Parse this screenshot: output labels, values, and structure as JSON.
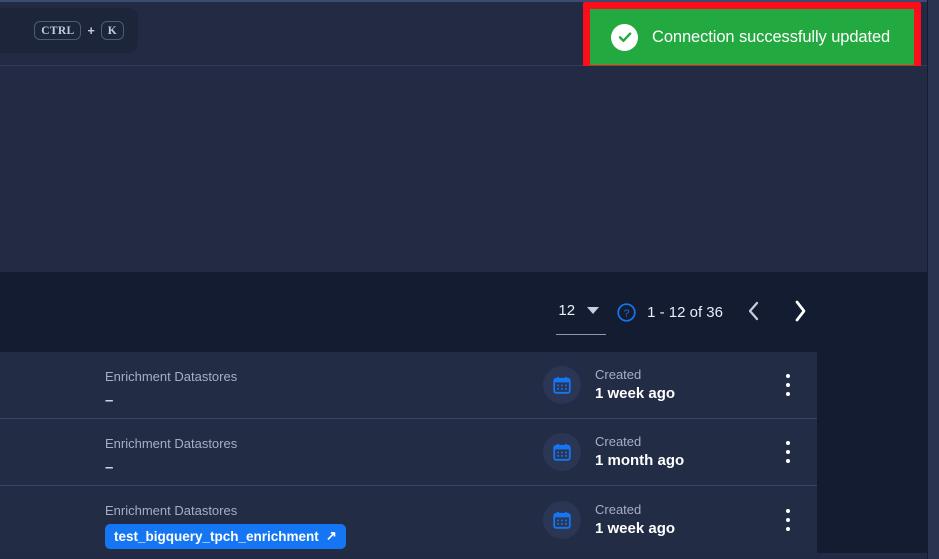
{
  "colors": {
    "app_background": "#1b2338",
    "header_band": "#222b43",
    "toolbar_background": "#141c32",
    "row_background": "#232c45",
    "toast_green": "#22a93f",
    "annotation_red": "#fc0d1b",
    "accent_blue": "#1476f2",
    "muted_text": "#a6aec4"
  },
  "header": {
    "search": {
      "shortcut_modifier": "CTRL",
      "shortcut_plus": "+",
      "shortcut_key": "K"
    },
    "toast": {
      "icon": "check-circle-icon",
      "message": "Connection successfully updated",
      "highlighted": true
    }
  },
  "toolbar": {
    "page_size": {
      "value": "12",
      "caret_icon": "chevron-down-icon"
    },
    "help_icon": "help-circle-icon",
    "range_label": "1 - 12 of 36",
    "prev_icon": "chevron-left-icon",
    "next_icon": "chevron-right-icon"
  },
  "list": {
    "rows": [
      {
        "kind": "Enrichment Datastores",
        "value": "–",
        "value_type": "text",
        "created_label": "Created",
        "created_value": "1 week ago",
        "calendar_icon": "calendar-icon",
        "menu_icon": "kebab-menu-icon"
      },
      {
        "kind": "Enrichment Datastores",
        "value": "–",
        "value_type": "text",
        "created_label": "Created",
        "created_value": "1 month ago",
        "calendar_icon": "calendar-icon",
        "menu_icon": "kebab-menu-icon"
      },
      {
        "kind": "Enrichment Datastores",
        "value": "test_bigquery_tpch_enrichment",
        "value_type": "chip",
        "chip_external_icon": "↗",
        "created_label": "Created",
        "created_value": "1 week ago",
        "calendar_icon": "calendar-icon",
        "menu_icon": "kebab-menu-icon"
      }
    ]
  }
}
